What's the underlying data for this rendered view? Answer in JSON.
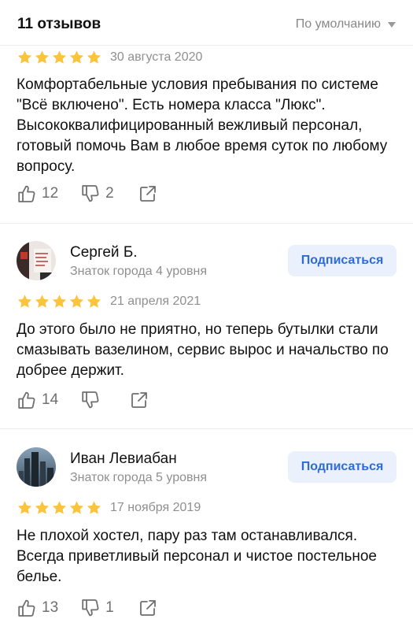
{
  "header": {
    "count_label": "11 отзывов",
    "sort_label": "По умолчанию"
  },
  "colors": {
    "star": "#fcc33c",
    "subscribe_bg": "#eaf1fd",
    "subscribe_text": "#2e6bd6",
    "muted": "#8f8f8f"
  },
  "reviews": [
    {
      "rating": 5,
      "date": "30 августа 2020",
      "text": "Комфортабельные условия пребывания по системе \"Всё включено\". Есть номера класса \"Люкс\". Высококвалифицированный вежливый персонал, готовый помочь Вам в любое время суток по любому вопросу.",
      "likes": "12",
      "dislikes": "2"
    },
    {
      "author": {
        "name": "Сергей Б.",
        "level": "Знаток города 4 уровня",
        "subscribe_label": "Подписаться"
      },
      "rating": 5,
      "date": "21 апреля 2021",
      "text": "До этого было не приятно, но теперь бутылки стали смазывать вазелином, сервис вырос и начальство по добрее держит.",
      "likes": "14",
      "dislikes": ""
    },
    {
      "author": {
        "name": "Иван Левиабан",
        "level": "Знаток города 5 уровня",
        "subscribe_label": "Подписаться"
      },
      "rating": 5,
      "date": "17 ноября 2019",
      "text": "Не плохой хостел, пару раз там останавливался. Всегда приветливый персонал и чистое постельное белье.",
      "likes": "13",
      "dislikes": "1"
    }
  ]
}
